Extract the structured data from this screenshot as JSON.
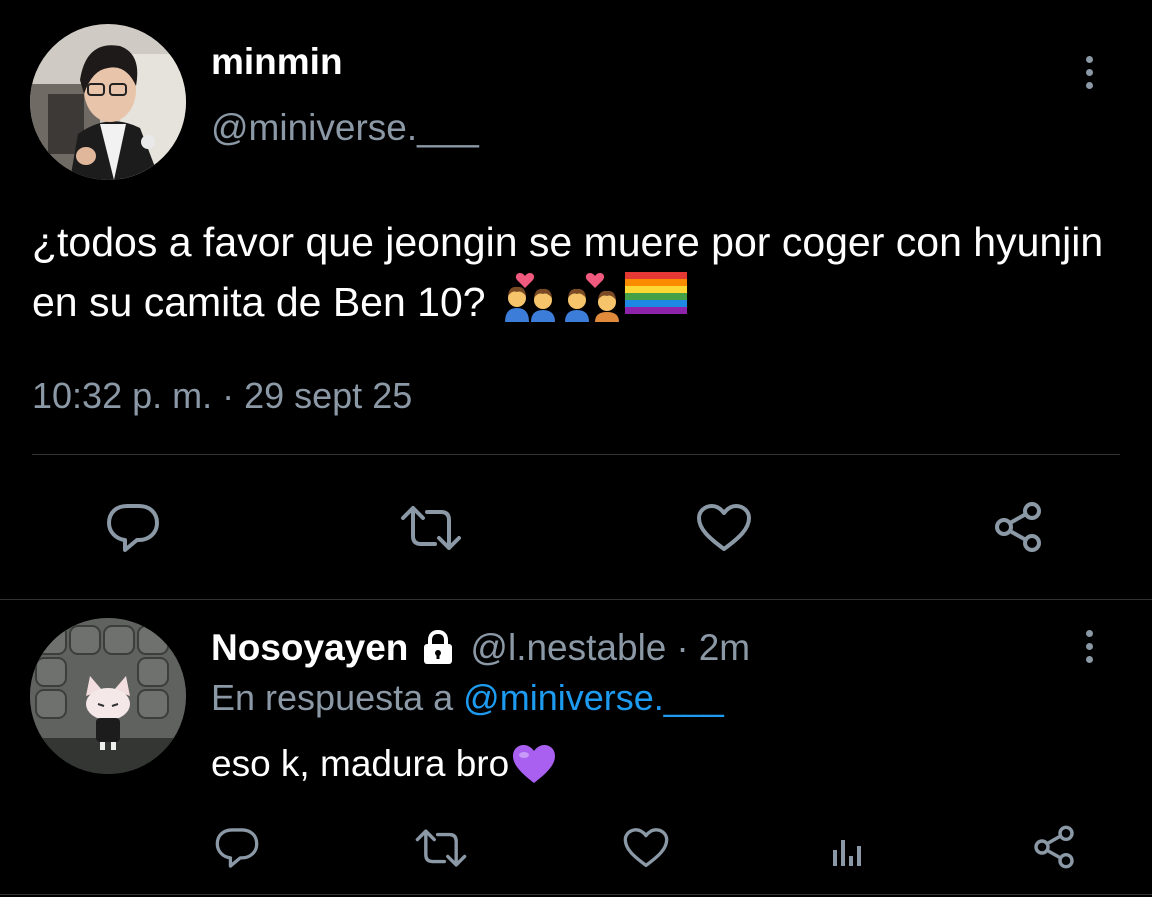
{
  "main_tweet": {
    "display_name": "minmin",
    "handle": "@miniverse.___",
    "text": "¿todos a favor que jeongin se muere por coger con hyunjin en su camita de Ben 10?",
    "emojis": [
      "couple-with-heart-man-man",
      "kiss-man-man",
      "rainbow-flag"
    ],
    "timestamp": "10:32 p. m. · 29 sept 25",
    "actions": [
      "reply-icon",
      "retweet-icon",
      "like-icon",
      "share-icon"
    ]
  },
  "reply": {
    "display_name": "Nosoyayen",
    "handle": "@l.nestable",
    "time": "2m",
    "meta_separator": "·",
    "replying_to_label": "En respuesta a",
    "replying_to_handle": "@miniverse.___",
    "text": "eso k, madura bro",
    "text_emoji": "purple-heart",
    "actions": [
      "reply-icon",
      "retweet-icon",
      "like-icon",
      "analytics-icon",
      "share-icon"
    ]
  },
  "colors": {
    "background": "#000000",
    "text": "#ffffff",
    "secondary": "#8b98a5",
    "link": "#1d9bf0",
    "divider": "#2f3336"
  }
}
